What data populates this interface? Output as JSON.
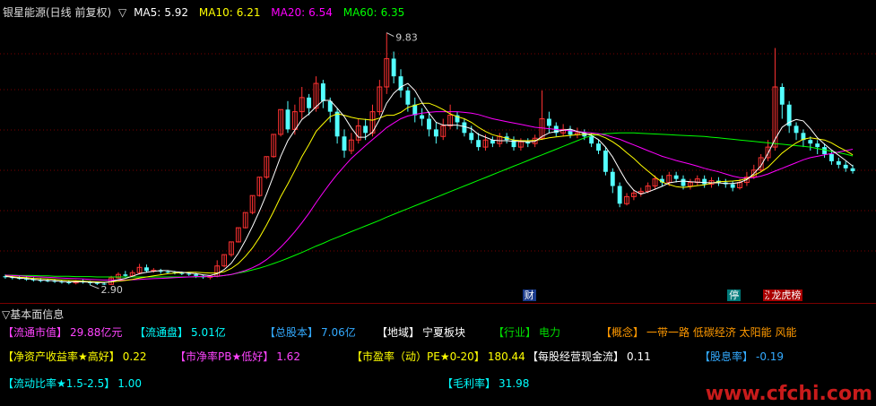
{
  "header": {
    "title": "银星能源(日线 前复权)",
    "toggle_icon": "triangle-down-icon",
    "ma": [
      {
        "label": "MA5:",
        "value": "5.92",
        "color": "#ffffff"
      },
      {
        "label": "MA10:",
        "value": "6.21",
        "color": "#ffff00"
      },
      {
        "label": "MA20:",
        "value": "6.54",
        "color": "#ff00ff"
      },
      {
        "label": "MA60:",
        "value": "6.35",
        "color": "#00ff00"
      }
    ]
  },
  "chart_data": {
    "type": "candlestick",
    "ylim": [
      2.6,
      10.2
    ],
    "high_label": "9.83",
    "low_label": "2.90",
    "up_color": "#ff3232",
    "down_color": "#54ffff",
    "candles": [
      [
        2.95,
        2.92,
        3.0,
        2.88
      ],
      [
        2.93,
        2.9,
        2.98,
        2.86
      ],
      [
        2.9,
        2.88,
        2.96,
        2.85
      ],
      [
        2.88,
        2.86,
        2.94,
        2.82
      ],
      [
        2.86,
        2.84,
        2.92,
        2.8
      ],
      [
        2.84,
        2.83,
        2.9,
        2.78
      ],
      [
        2.83,
        2.82,
        2.88,
        2.78
      ],
      [
        2.82,
        2.8,
        2.86,
        2.76
      ],
      [
        2.8,
        2.78,
        2.85,
        2.74
      ],
      [
        2.78,
        2.76,
        2.83,
        2.72
      ],
      [
        2.76,
        2.8,
        2.84,
        2.72
      ],
      [
        2.8,
        2.78,
        2.86,
        2.74
      ],
      [
        2.78,
        2.76,
        2.82,
        2.7
      ],
      [
        2.76,
        2.74,
        2.8,
        2.7
      ],
      [
        2.74,
        2.72,
        2.78,
        2.7
      ],
      [
        2.72,
        2.9,
        2.96,
        2.7
      ],
      [
        2.9,
        3.0,
        3.06,
        2.88
      ],
      [
        3.0,
        2.96,
        3.1,
        2.92
      ],
      [
        2.96,
        3.05,
        3.12,
        2.94
      ],
      [
        3.05,
        3.2,
        3.3,
        3.0
      ],
      [
        3.2,
        3.1,
        3.28,
        3.05
      ],
      [
        3.1,
        3.12,
        3.18,
        3.05
      ],
      [
        3.12,
        3.08,
        3.16,
        3.02
      ],
      [
        3.08,
        3.06,
        3.12,
        3.02
      ],
      [
        3.06,
        3.04,
        3.1,
        3.0
      ],
      [
        3.04,
        3.02,
        3.08,
        2.98
      ],
      [
        3.02,
        3.0,
        3.06,
        2.96
      ],
      [
        3.0,
        2.96,
        3.04,
        2.9
      ],
      [
        2.96,
        2.92,
        3.0,
        2.88
      ],
      [
        2.92,
        2.95,
        2.98,
        2.86
      ],
      [
        2.95,
        3.24,
        3.4,
        2.92
      ],
      [
        3.24,
        3.56,
        3.56,
        3.2
      ],
      [
        3.56,
        3.92,
        3.92,
        3.5
      ],
      [
        3.92,
        4.32,
        4.32,
        3.9
      ],
      [
        4.32,
        4.75,
        4.75,
        4.3
      ],
      [
        4.75,
        5.23,
        5.23,
        4.7
      ],
      [
        5.23,
        5.75,
        5.75,
        5.2
      ],
      [
        5.75,
        6.33,
        6.33,
        5.7
      ],
      [
        6.33,
        6.96,
        6.96,
        6.3
      ],
      [
        6.96,
        7.66,
        7.66,
        6.9
      ],
      [
        7.66,
        7.1,
        7.9,
        7.0
      ],
      [
        7.1,
        7.6,
        7.8,
        6.95
      ],
      [
        7.6,
        8.0,
        8.3,
        7.4
      ],
      [
        8.0,
        7.7,
        8.1,
        7.5
      ],
      [
        7.7,
        8.4,
        8.6,
        7.6
      ],
      [
        8.4,
        7.9,
        8.5,
        7.7
      ],
      [
        7.9,
        7.6,
        8.0,
        7.3
      ],
      [
        7.6,
        6.9,
        7.7,
        6.7
      ],
      [
        6.9,
        6.5,
        7.1,
        6.3
      ],
      [
        6.5,
        6.8,
        7.0,
        6.4
      ],
      [
        6.8,
        7.2,
        7.4,
        6.7
      ],
      [
        7.2,
        7.0,
        7.4,
        6.8
      ],
      [
        7.0,
        7.6,
        7.8,
        6.9
      ],
      [
        7.6,
        8.3,
        8.5,
        7.5
      ],
      [
        8.3,
        9.1,
        9.83,
        8.1
      ],
      [
        9.1,
        8.6,
        9.3,
        8.4
      ],
      [
        8.6,
        8.2,
        8.8,
        8.0
      ],
      [
        8.2,
        7.8,
        8.3,
        7.6
      ],
      [
        7.8,
        7.5,
        8.0,
        7.3
      ],
      [
        7.5,
        7.4,
        7.7,
        7.2
      ],
      [
        7.4,
        7.1,
        7.6,
        6.9
      ],
      [
        7.1,
        6.9,
        7.3,
        6.7
      ],
      [
        6.9,
        7.2,
        7.4,
        6.8
      ],
      [
        7.2,
        7.5,
        7.8,
        7.1
      ],
      [
        7.5,
        7.3,
        7.6,
        7.1
      ],
      [
        7.3,
        7.0,
        7.4,
        6.9
      ],
      [
        7.0,
        6.8,
        7.2,
        6.7
      ],
      [
        6.8,
        6.6,
        7.0,
        6.5
      ],
      [
        6.6,
        6.8,
        6.95,
        6.5
      ],
      [
        6.8,
        6.7,
        6.9,
        6.6
      ],
      [
        6.7,
        6.9,
        7.0,
        6.6
      ],
      [
        6.9,
        6.8,
        7.0,
        6.7
      ],
      [
        6.8,
        6.6,
        6.9,
        6.5
      ],
      [
        6.6,
        6.75,
        6.85,
        6.5
      ],
      [
        6.75,
        6.7,
        6.85,
        6.6
      ],
      [
        6.7,
        6.85,
        6.95,
        6.6
      ],
      [
        6.85,
        7.4,
        8.2,
        6.8
      ],
      [
        7.4,
        7.2,
        7.6,
        7.0
      ],
      [
        7.2,
        7.0,
        7.3,
        6.9
      ],
      [
        7.0,
        7.1,
        7.25,
        6.9
      ],
      [
        7.1,
        6.95,
        7.2,
        6.85
      ],
      [
        6.95,
        7.0,
        7.15,
        6.85
      ],
      [
        7.0,
        6.9,
        7.1,
        6.8
      ],
      [
        6.9,
        6.7,
        7.0,
        6.6
      ],
      [
        6.7,
        6.5,
        6.8,
        6.4
      ],
      [
        6.5,
        5.9,
        6.6,
        5.8
      ],
      [
        5.9,
        5.5,
        6.0,
        5.3
      ],
      [
        5.5,
        5.0,
        5.6,
        4.9
      ],
      [
        5.0,
        5.2,
        5.3,
        4.95
      ],
      [
        5.2,
        5.3,
        5.4,
        5.1
      ],
      [
        5.3,
        5.35,
        5.45,
        5.2
      ],
      [
        5.35,
        5.5,
        5.6,
        5.3
      ],
      [
        5.5,
        5.7,
        5.8,
        5.4
      ],
      [
        5.7,
        5.6,
        5.8,
        5.5
      ],
      [
        5.6,
        5.8,
        5.9,
        5.5
      ],
      [
        5.8,
        5.7,
        5.9,
        5.6
      ],
      [
        5.7,
        5.5,
        5.8,
        5.4
      ],
      [
        5.5,
        5.6,
        5.7,
        5.4
      ],
      [
        5.6,
        5.7,
        5.8,
        5.5
      ],
      [
        5.7,
        5.55,
        5.8,
        5.45
      ],
      [
        5.55,
        5.65,
        5.75,
        5.45
      ],
      [
        5.65,
        5.6,
        5.75,
        5.5
      ],
      [
        5.6,
        5.55,
        5.7,
        5.45
      ],
      [
        5.55,
        5.45,
        5.65,
        5.35
      ],
      [
        5.45,
        5.6,
        5.7,
        5.4
      ],
      [
        5.6,
        5.75,
        5.9,
        5.5
      ],
      [
        5.75,
        5.95,
        6.1,
        5.7
      ],
      [
        5.95,
        6.3,
        6.4,
        5.9
      ],
      [
        6.3,
        6.6,
        6.8,
        6.2
      ],
      [
        6.6,
        8.3,
        9.4,
        6.5
      ],
      [
        8.3,
        7.8,
        8.4,
        7.4
      ],
      [
        7.8,
        7.2,
        7.9,
        7.0
      ],
      [
        7.2,
        7.0,
        7.3,
        6.8
      ],
      [
        7.0,
        6.8,
        7.1,
        6.6
      ],
      [
        6.8,
        6.7,
        6.9,
        6.5
      ],
      [
        6.7,
        6.6,
        6.8,
        6.4
      ],
      [
        6.6,
        6.4,
        6.7,
        6.3
      ],
      [
        6.4,
        6.2,
        6.5,
        6.1
      ],
      [
        6.2,
        6.1,
        6.3,
        6.0
      ],
      [
        6.1,
        6.0,
        6.2,
        5.9
      ],
      [
        6.0,
        5.92,
        6.1,
        5.85
      ]
    ],
    "ma5": [
      2.95,
      2.92,
      2.9,
      2.88,
      2.86,
      2.84,
      2.83,
      2.82,
      2.8,
      2.79,
      2.79,
      2.79,
      2.78,
      2.77,
      2.77,
      2.8,
      2.85,
      2.89,
      2.95,
      3.02,
      3.06,
      3.09,
      3.11,
      3.11,
      3.08,
      3.06,
      3.04,
      3.02,
      2.99,
      2.97,
      3.02,
      3.14,
      3.32,
      3.6,
      3.96,
      4.36,
      4.8,
      5.28,
      5.8,
      6.34,
      6.78,
      7.08,
      7.38,
      7.54,
      7.74,
      7.92,
      7.92,
      7.7,
      7.46,
      7.14,
      6.88,
      6.88,
      7.02,
      7.38,
      7.84,
      8.12,
      8.3,
      8.4,
      8.2,
      7.86,
      7.56,
      7.3,
      7.22,
      7.22,
      7.22,
      7.18,
      7.12,
      6.96,
      6.88,
      6.8,
      6.78,
      6.78,
      6.76,
      6.76,
      6.75,
      6.76,
      6.9,
      7.0,
      7.04,
      7.08,
      7.11,
      7.04,
      6.99,
      6.93,
      6.81,
      6.6,
      6.32,
      5.96,
      5.62,
      5.38,
      5.27,
      5.33,
      5.41,
      5.49,
      5.59,
      5.62,
      5.64,
      5.62,
      5.61,
      5.6,
      5.59,
      5.59,
      5.57,
      5.57,
      5.6,
      5.68,
      5.85,
      6.07,
      6.42,
      6.82,
      7.16,
      7.3,
      7.38,
      7.34,
      7.12,
      6.86,
      6.68,
      6.52,
      6.37,
      6.22,
      6.06
    ],
    "ma10": [
      2.96,
      2.94,
      2.92,
      2.91,
      2.89,
      2.88,
      2.87,
      2.86,
      2.84,
      2.83,
      2.82,
      2.81,
      2.8,
      2.79,
      2.78,
      2.79,
      2.81,
      2.83,
      2.86,
      2.9,
      2.93,
      2.96,
      2.99,
      3.02,
      3.04,
      3.05,
      3.06,
      3.06,
      3.05,
      3.04,
      3.04,
      3.08,
      3.17,
      3.31,
      3.51,
      3.75,
      4.05,
      4.4,
      4.78,
      5.2,
      5.56,
      5.94,
      6.33,
      6.67,
      7.04,
      7.26,
      7.46,
      7.54,
      7.5,
      7.44,
      7.4,
      7.38,
      7.36,
      7.42,
      7.5,
      7.5,
      7.58,
      7.72,
      7.78,
      7.84,
      7.84,
      7.76,
      7.66,
      7.54,
      7.46,
      7.4,
      7.3,
      7.16,
      7.04,
      6.95,
      6.9,
      6.85,
      6.8,
      6.78,
      6.78,
      6.79,
      6.82,
      6.86,
      6.89,
      6.91,
      6.93,
      6.95,
      6.96,
      6.97,
      6.94,
      6.86,
      6.75,
      6.61,
      6.44,
      6.28,
      6.09,
      5.92,
      5.76,
      5.61,
      5.54,
      5.48,
      5.46,
      5.48,
      5.51,
      5.53,
      5.58,
      5.62,
      5.63,
      5.64,
      5.66,
      5.71,
      5.8,
      5.9,
      6.03,
      6.23,
      6.43,
      6.58,
      6.72,
      6.82,
      6.86,
      6.83,
      6.8,
      6.72,
      6.6,
      6.5,
      6.38
    ],
    "ma20": [
      2.98,
      2.97,
      2.96,
      2.95,
      2.94,
      2.93,
      2.92,
      2.91,
      2.9,
      2.89,
      2.88,
      2.87,
      2.86,
      2.85,
      2.84,
      2.84,
      2.84,
      2.84,
      2.85,
      2.86,
      2.87,
      2.88,
      2.89,
      2.9,
      2.91,
      2.92,
      2.93,
      2.94,
      2.94,
      2.94,
      2.95,
      2.97,
      3.0,
      3.05,
      3.11,
      3.19,
      3.29,
      3.42,
      3.58,
      3.77,
      3.98,
      4.21,
      4.46,
      4.73,
      5.03,
      5.31,
      5.58,
      5.83,
      6.06,
      6.28,
      6.46,
      6.64,
      6.81,
      6.98,
      7.15,
      7.28,
      7.4,
      7.48,
      7.52,
      7.56,
      7.58,
      7.6,
      7.6,
      7.6,
      7.6,
      7.58,
      7.56,
      7.52,
      7.46,
      7.4,
      7.36,
      7.32,
      7.28,
      7.24,
      7.2,
      7.16,
      7.14,
      7.12,
      7.1,
      7.08,
      7.06,
      7.04,
      7.02,
      7.0,
      6.98,
      6.94,
      6.88,
      6.82,
      6.74,
      6.66,
      6.58,
      6.5,
      6.42,
      6.34,
      6.28,
      6.22,
      6.17,
      6.12,
      6.06,
      6.0,
      5.95,
      5.9,
      5.84,
      5.78,
      5.74,
      5.72,
      5.74,
      5.78,
      5.84,
      5.92,
      6.0,
      6.08,
      6.16,
      6.24,
      6.3,
      6.34,
      6.38,
      6.42,
      6.46,
      6.5,
      6.54
    ],
    "ma60": [
      2.98,
      2.98,
      2.97,
      2.97,
      2.97,
      2.96,
      2.96,
      2.95,
      2.95,
      2.95,
      2.94,
      2.94,
      2.94,
      2.93,
      2.93,
      2.93,
      2.93,
      2.93,
      2.93,
      2.93,
      2.93,
      2.93,
      2.93,
      2.93,
      2.93,
      2.93,
      2.93,
      2.93,
      2.94,
      2.94,
      2.95,
      2.97,
      3.0,
      3.04,
      3.08,
      3.13,
      3.18,
      3.24,
      3.31,
      3.38,
      3.46,
      3.54,
      3.62,
      3.71,
      3.8,
      3.88,
      3.97,
      4.05,
      4.13,
      4.21,
      4.29,
      4.37,
      4.45,
      4.53,
      4.62,
      4.7,
      4.78,
      4.86,
      4.94,
      5.02,
      5.1,
      5.18,
      5.26,
      5.34,
      5.42,
      5.5,
      5.58,
      5.66,
      5.74,
      5.82,
      5.9,
      5.98,
      6.06,
      6.14,
      6.22,
      6.3,
      6.38,
      6.46,
      6.54,
      6.62,
      6.7,
      6.78,
      6.86,
      6.92,
      6.96,
      6.98,
      6.99,
      7.0,
      7.0,
      7.0,
      6.99,
      6.98,
      6.97,
      6.96,
      6.95,
      6.94,
      6.93,
      6.92,
      6.91,
      6.9,
      6.88,
      6.86,
      6.84,
      6.82,
      6.8,
      6.78,
      6.76,
      6.74,
      6.72,
      6.7,
      6.68,
      6.66,
      6.64,
      6.62,
      6.6,
      6.56,
      6.52,
      6.48,
      6.44,
      6.4,
      6.35
    ]
  },
  "badges": [
    {
      "text": "财",
      "color": "#ffffff",
      "bg": "#1a3a8a",
      "idx": 74
    },
    {
      "text": "停",
      "color": "#ffffff",
      "bg": "#007a7a",
      "idx": 103
    },
    {
      "text": "汉",
      "color": "#ffffff",
      "bg": "#aa0000",
      "idx": 108
    },
    {
      "text": "龙虎榜",
      "color": "#ffffff",
      "bg": "#aa0000",
      "idx": 109
    }
  ],
  "panel": {
    "title": "基本面信息",
    "toggle_icon": "triangle-down-icon",
    "items": [
      {
        "label": "【流通市值】",
        "value": "29.88亿元",
        "color": "#ff44ff"
      },
      {
        "label": "【流通盘】",
        "value": "5.01亿",
        "color": "#00ffff"
      },
      {
        "label": "【总股本】",
        "value": "7.06亿",
        "color": "#33aaff"
      },
      {
        "label": "【地域】",
        "value": "宁夏板块",
        "color": "#ffffff"
      },
      {
        "label": "【行业】",
        "value": "电力",
        "color": "#00dd00"
      },
      {
        "label": "【概念】",
        "value": "一带一路 低碳经济 太阳能 风能",
        "color": "#ff9900"
      },
      {
        "label": "【净资产收益率★高好】",
        "value": "0.22",
        "color": "#ffff00"
      },
      {
        "label": "【市净率PB★低好】",
        "value": "1.62",
        "color": "#ff44ff"
      },
      {
        "label": "【市盈率（动）PE★0-20】",
        "value": "180.44",
        "color": "#ffff00"
      },
      {
        "label": "【每股经营现金流】",
        "value": "0.11",
        "color": "#ffffff"
      },
      {
        "label": "【股息率】",
        "value": "-0.19",
        "color": "#33aaff"
      },
      {
        "label": "【流动比率★1.5-2.5】",
        "value": "1.00",
        "color": "#00ffff"
      },
      {
        "label": "【毛利率】",
        "value": "31.98",
        "color": "#00ffff"
      }
    ]
  },
  "watermark": "www.cfchi.com"
}
